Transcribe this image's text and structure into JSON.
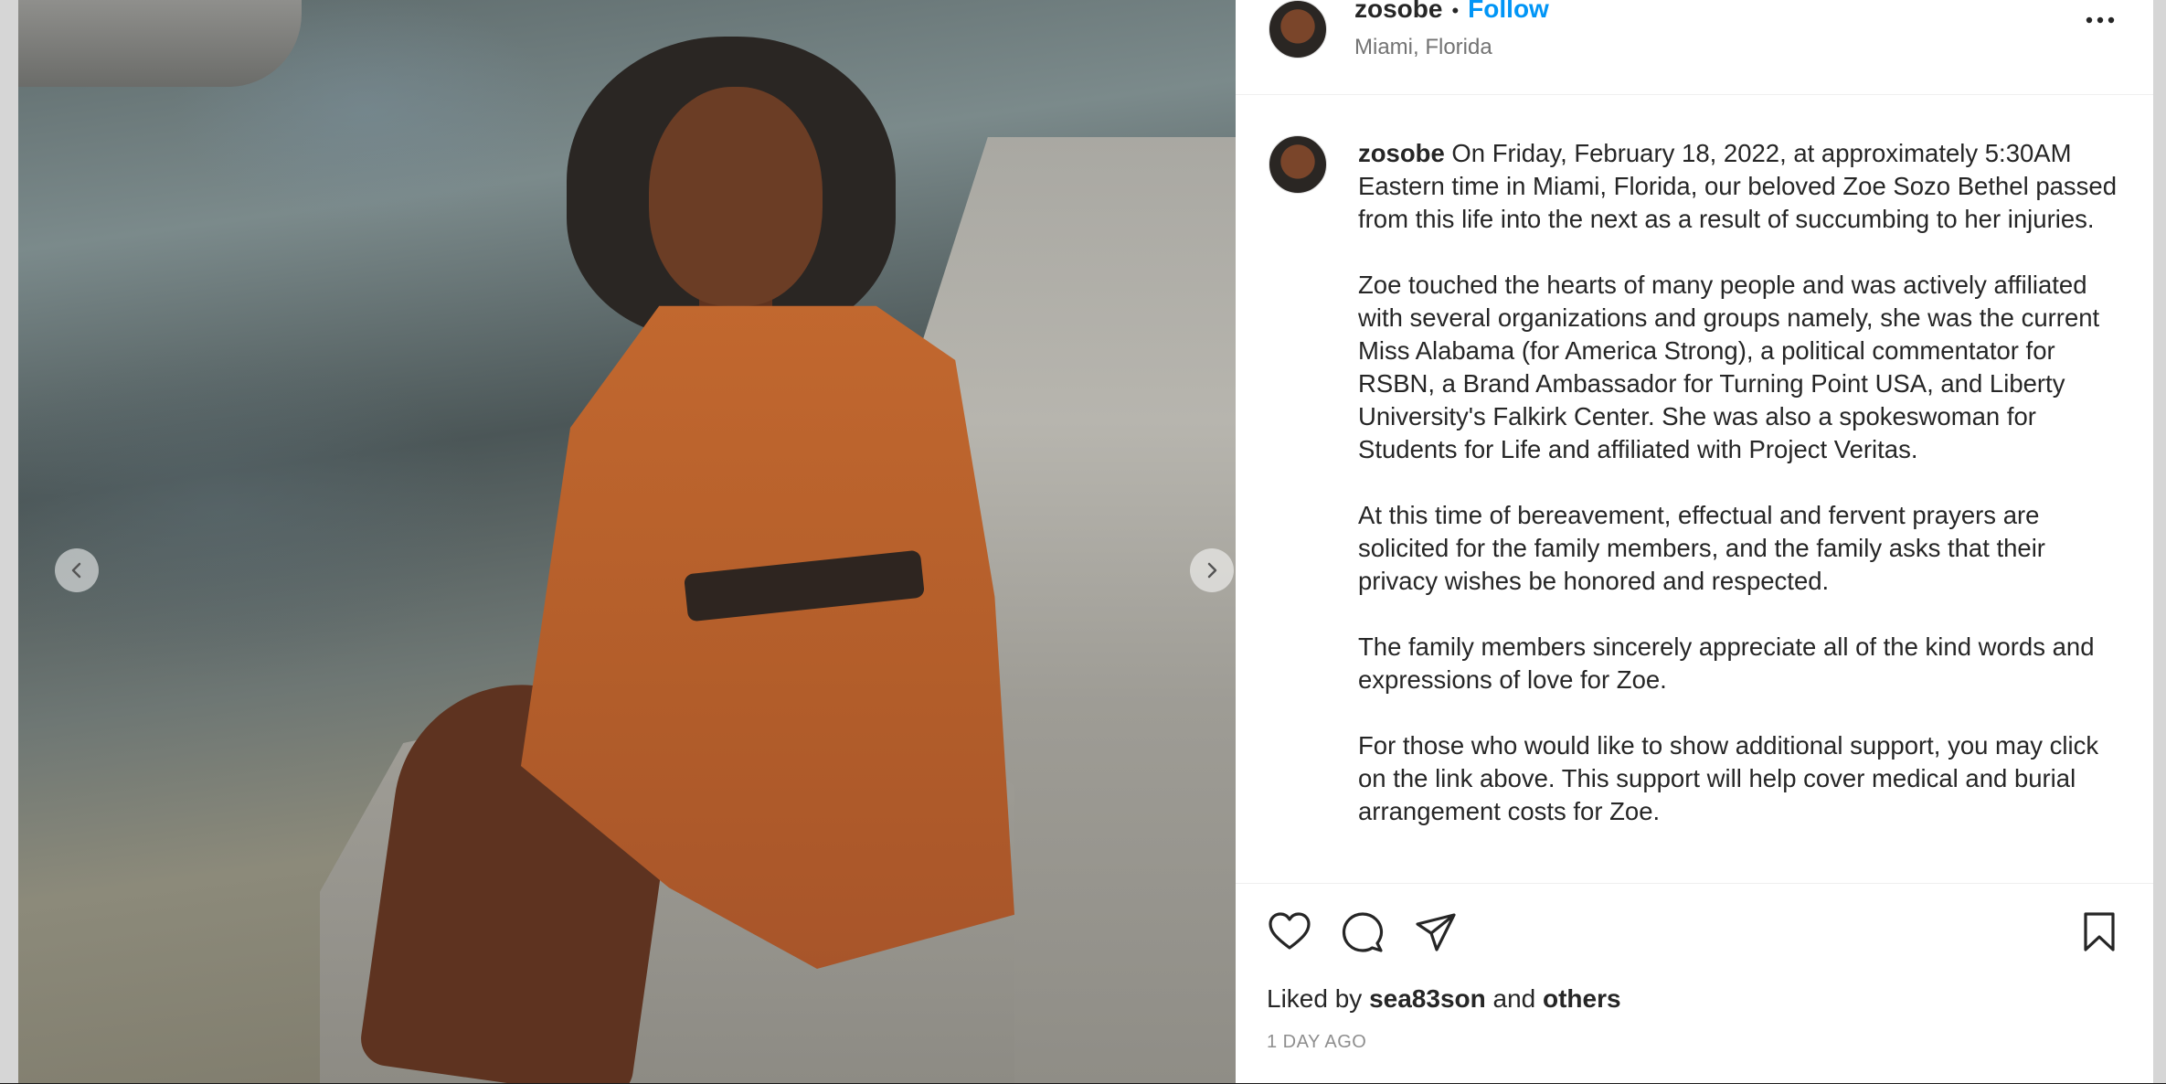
{
  "post": {
    "username": "zosobe",
    "follow_label": "Follow",
    "separator": "•",
    "location": "Miami, Florida",
    "caption_username": "zosobe",
    "caption_paragraphs": [
      "On Friday, February 18, 2022, at approximately 5:30AM Eastern time in Miami, Florida, our beloved Zoe Sozo Bethel passed from this life into the next as a result of succumbing to her injuries.",
      "Zoe touched the hearts of many people and was actively affiliated with several organizations and groups namely, she was the current Miss Alabama (for America Strong), a political commentator for RSBN, a Brand Ambassador for Turning Point USA, and Liberty University's Falkirk Center. She was also a spokeswoman for Students for Life and affiliated with Project Veritas.",
      "At this time of bereavement, effectual and fervent prayers are solicited for the family members, and the family asks that their privacy wishes be honored and respected.",
      "The family members sincerely appreciate all of the kind words and expressions of love for Zoe.",
      "For those who would like to show additional support, you may click on the link above. This support will help cover medical and burial arrangement costs for Zoe."
    ],
    "likes_prefix": "Liked by",
    "liked_by_user": "sea83son",
    "likes_joiner": "and",
    "likes_others": "others",
    "timestamp": "1 DAY AGO"
  },
  "icons": {
    "more": "more-options-icon",
    "like": "heart-icon",
    "comment": "comment-icon",
    "share": "paper-plane-icon",
    "save": "bookmark-icon",
    "prev": "chevron-left-icon",
    "next": "chevron-right-icon"
  },
  "colors": {
    "follow": "#0095f6",
    "text": "#262626",
    "secondary": "#737373",
    "dress": "#c2682f"
  }
}
